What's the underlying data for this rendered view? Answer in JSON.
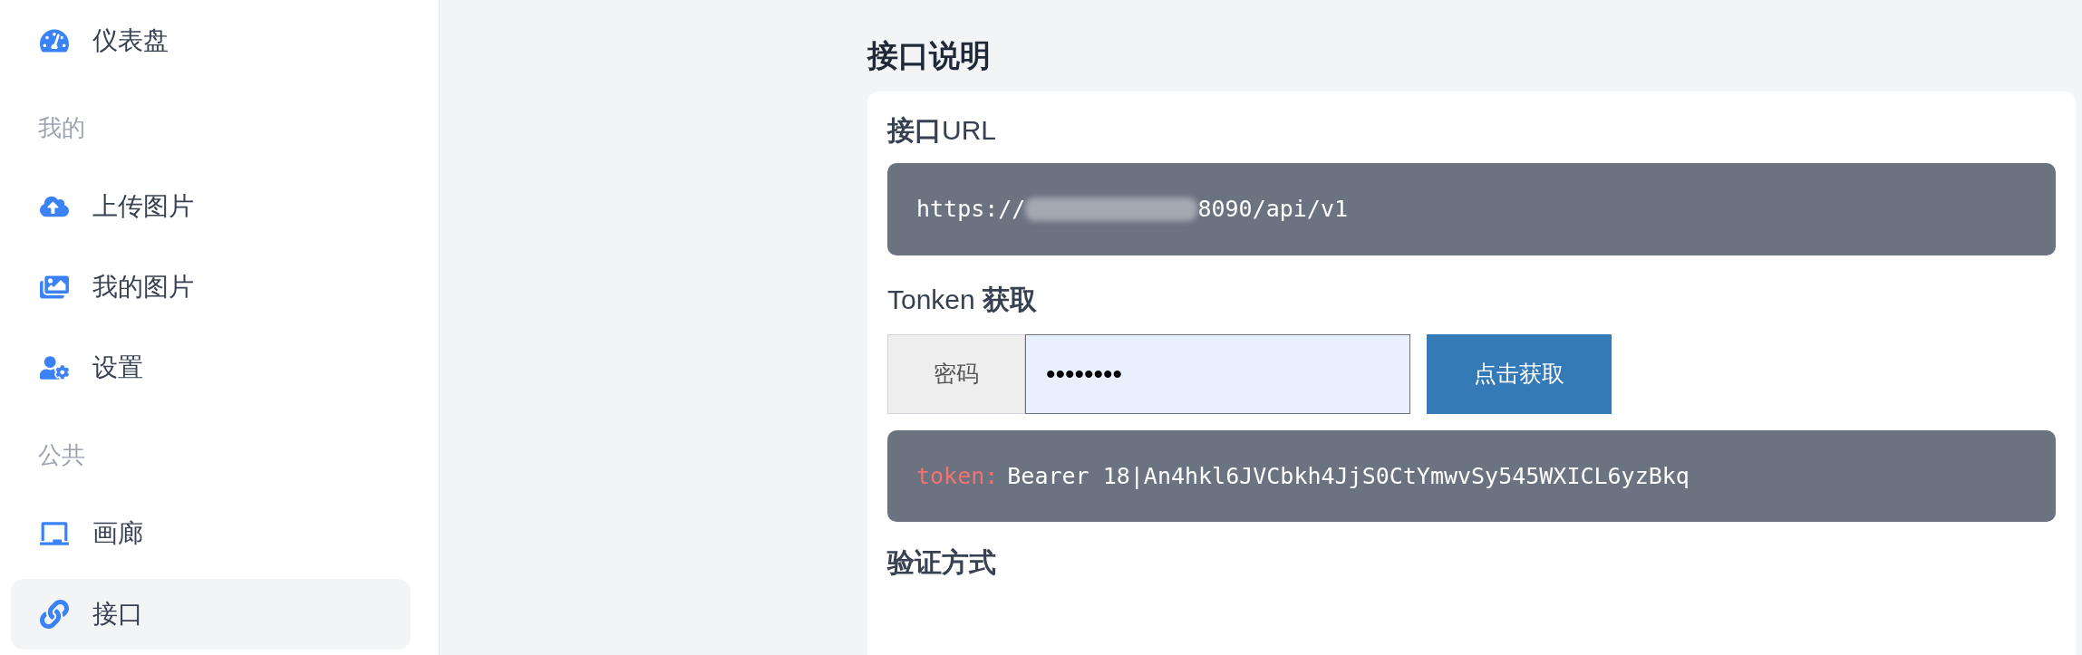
{
  "sidebar": {
    "items": [
      {
        "kind": "item",
        "label": "仪表盘",
        "selected": false
      },
      {
        "kind": "section",
        "label": "我的"
      },
      {
        "kind": "item",
        "label": "上传图片",
        "selected": false
      },
      {
        "kind": "item",
        "label": "我的图片",
        "selected": false
      },
      {
        "kind": "item",
        "label": "设置",
        "selected": false
      },
      {
        "kind": "section",
        "label": "公共"
      },
      {
        "kind": "item",
        "label": "画廊",
        "selected": false
      },
      {
        "kind": "item",
        "label": "接口",
        "selected": true
      }
    ]
  },
  "page_title": "接口说明",
  "api_url": {
    "heading": "**接口**URL",
    "prefix": "https://",
    "suffix": "8090/api/v1"
  },
  "token": {
    "heading": "Tonken **获取**",
    "field_label": "密码",
    "password": "••••••••",
    "button": "点击获取",
    "result_key": "token:",
    "result_value": "Bearer 18|An4hkl6JVCbkh4JjS0CtYmwvSy545WXICL6yzBkq"
  },
  "auth_heading": "验证方式"
}
